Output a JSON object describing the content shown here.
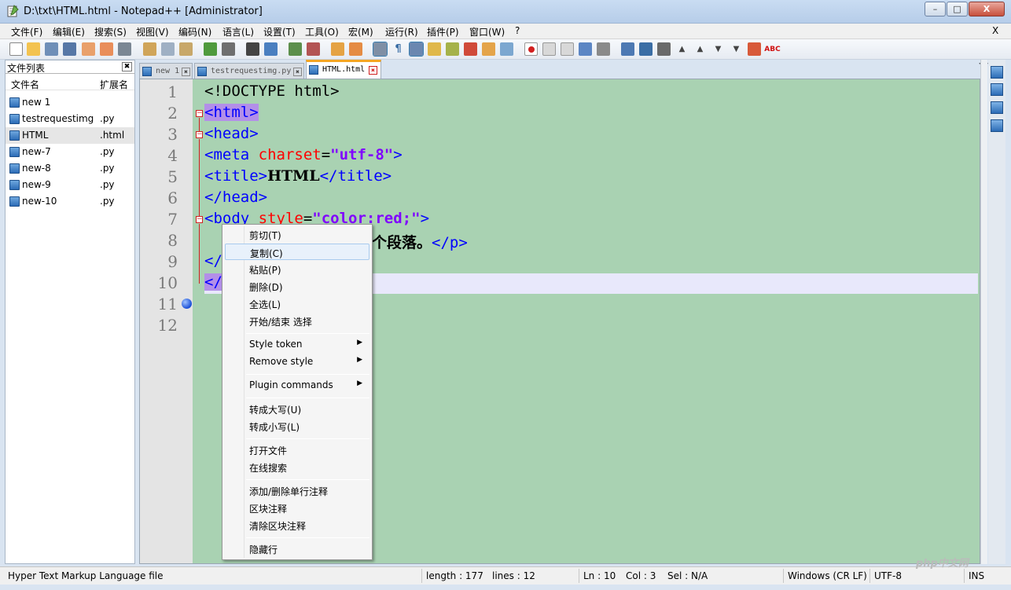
{
  "window": {
    "title": "D:\\txt\\HTML.html - Notepad++ [Administrator]",
    "min_glyph": "–",
    "max_glyph": "□",
    "close_glyph": "X"
  },
  "menu": {
    "items": [
      "文件(F)",
      "编辑(E)",
      "搜索(S)",
      "视图(V)",
      "编码(N)",
      "语言(L)",
      "设置(T)",
      "工具(O)",
      "宏(M)",
      "运行(R)",
      "插件(P)",
      "窗口(W)",
      "?"
    ],
    "close": "X"
  },
  "toolbar": {
    "spellcheck_label": "ABC"
  },
  "filelist": {
    "title": "文件列表",
    "close_glyph": "✖",
    "col_name": "文件名",
    "col_ext": "扩展名",
    "files": [
      {
        "name": "new 1",
        "ext": ""
      },
      {
        "name": "testrequestimg",
        "ext": ".py"
      },
      {
        "name": "HTML",
        "ext": ".html"
      },
      {
        "name": "new-7",
        "ext": ".py"
      },
      {
        "name": "new-8",
        "ext": ".py"
      },
      {
        "name": "new-9",
        "ext": ".py"
      },
      {
        "name": "new-10",
        "ext": ".py"
      }
    ]
  },
  "tabs": [
    {
      "label": "new 1",
      "active": false
    },
    {
      "label": "testrequestimg.py",
      "active": false
    },
    {
      "label": "HTML.html",
      "active": true
    }
  ],
  "tab_close_glyph": "✖",
  "tab_arrows": "◄►",
  "editor": {
    "line_numbers": [
      "1",
      "2",
      "3",
      "4",
      "5",
      "6",
      "7",
      "8",
      "9",
      "10",
      "11",
      "12"
    ],
    "fold_open": "−",
    "lines": {
      "l1": "<!DOCTYPE html>",
      "l2_tag": "<html>",
      "l3": "<head>",
      "l4_open": "<meta ",
      "l4_attr": "charset",
      "l4_eq": "=",
      "l4_val": "\"utf-8\"",
      "l4_close": ">",
      "l5_open": "<title>",
      "l5_text": "HTML",
      "l5_close": "</title>",
      "l6": "</head>",
      "l7_open": "<body ",
      "l7_attr": "style",
      "l7_eq": "=",
      "l7_val": "\"color:red;\"",
      "l7_close": ">",
      "l8_text": "个段落。",
      "l8_close": "</p>",
      "l9": "</",
      "l10": "</"
    }
  },
  "context_menu": {
    "items": [
      {
        "label": "剪切(T)"
      },
      {
        "label": "复制(C)"
      },
      {
        "label": "粘贴(P)"
      },
      {
        "label": "删除(D)"
      },
      {
        "label": "全选(L)"
      },
      {
        "label": "开始/结束 选择"
      },
      {
        "label": "Style token"
      },
      {
        "label": "Remove style"
      },
      {
        "label": "Plugin commands"
      },
      {
        "label": "转成大写(U)"
      },
      {
        "label": "转成小写(L)"
      },
      {
        "label": "打开文件"
      },
      {
        "label": "在线搜索"
      },
      {
        "label": "添加/删除单行注释"
      },
      {
        "label": "区块注释"
      },
      {
        "label": "清除区块注释"
      },
      {
        "label": "隐藏行"
      }
    ],
    "submenu_arrow": "▶"
  },
  "statusbar": {
    "filetype": "Hyper Text Markup Language file",
    "length": "length : 177",
    "lines": "lines : 12",
    "ln": "Ln : 10",
    "col": "Col : 3",
    "sel": "Sel : N/A",
    "eol": "Windows (CR LF)",
    "encoding": "UTF-8",
    "mode": "INS"
  },
  "watermark": "php中文网"
}
